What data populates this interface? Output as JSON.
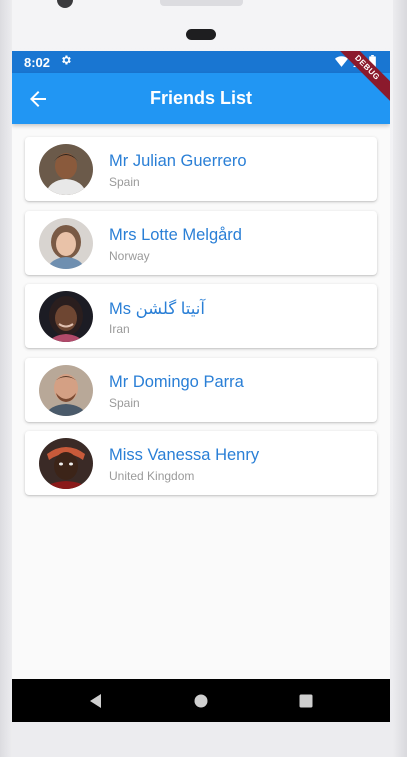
{
  "status_bar": {
    "time": "8:02",
    "debug_label": "DEBUG"
  },
  "app_bar": {
    "title": "Friends List",
    "back_icon": "arrow-back-icon"
  },
  "friends": [
    {
      "name": "Mr Julian Guerrero",
      "country": "Spain"
    },
    {
      "name": "Mrs Lotte Melgård",
      "country": "Norway"
    },
    {
      "name": "Ms آنیتا گلشن",
      "country": "Iran"
    },
    {
      "name": "Mr Domingo Parra",
      "country": "Spain"
    },
    {
      "name": "Miss Vanessa Henry",
      "country": "United Kingdom"
    }
  ],
  "colors": {
    "app_bar": "#2196f3",
    "status_bar": "#1976d2",
    "name_text": "#2a7fd6",
    "subtitle_text": "#9a9a9a"
  },
  "nav_bar": {
    "back": "nav-back-icon",
    "home": "nav-home-icon",
    "recents": "nav-recents-icon"
  }
}
